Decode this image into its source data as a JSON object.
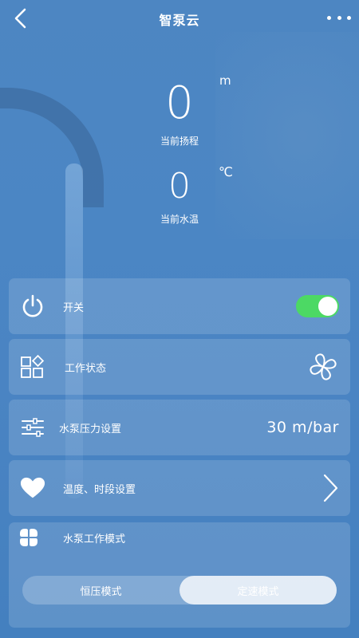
{
  "header": {
    "title": "智泵云",
    "back_icon": "chevron-left-icon",
    "more_icon": "more-dots-icon"
  },
  "readings": {
    "head": {
      "value": "0",
      "unit": "m",
      "label": "当前扬程"
    },
    "temperature": {
      "value": "0",
      "unit": "℃",
      "label": "当前水温"
    }
  },
  "controls": {
    "power": {
      "label": "开关",
      "icon": "power-icon",
      "switch_on": true,
      "switch_color": "#4cd964"
    },
    "status": {
      "label": "工作状态",
      "icon": "grid-shapes-icon",
      "status_icon": "fan-icon"
    },
    "pressure": {
      "label": "水泵压力设置",
      "icon": "sliders-icon",
      "value": "30 m/bar"
    },
    "schedule": {
      "label": "温度、时段设置",
      "icon": "heart-icon",
      "action_icon": "chevron-right-icon"
    },
    "mode": {
      "label": "水泵工作模式",
      "icon": "clover-icon",
      "options": [
        "恒压模式",
        "定速模式"
      ],
      "selected": "定速模式"
    }
  }
}
